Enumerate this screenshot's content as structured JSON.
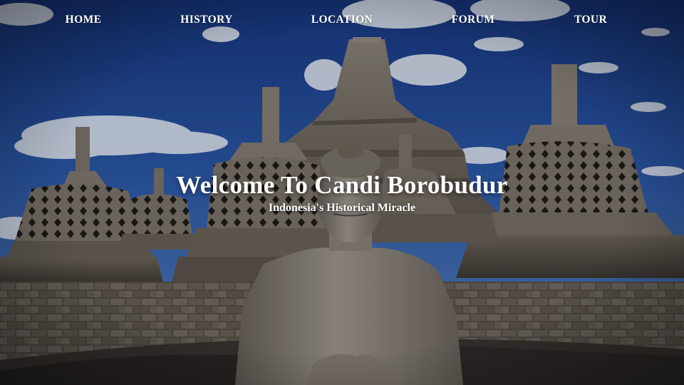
{
  "nav": {
    "items": [
      {
        "label": "HOME"
      },
      {
        "label": "HISTORY"
      },
      {
        "label": "LOCATION"
      },
      {
        "label": "FORUM"
      },
      {
        "label": "TOUR"
      }
    ]
  },
  "hero": {
    "title": "Welcome To Candi Borobudur",
    "subtitle": "Indonesia's Historical Miracle"
  },
  "colors": {
    "sky_top": "#1c3f92",
    "sky_bottom": "#4d79bf",
    "stone_light": "#8f8577",
    "stone_dark": "#4e463d",
    "text": "#ffffff"
  },
  "background_image": "borobudur-stupas-and-buddha-statue"
}
